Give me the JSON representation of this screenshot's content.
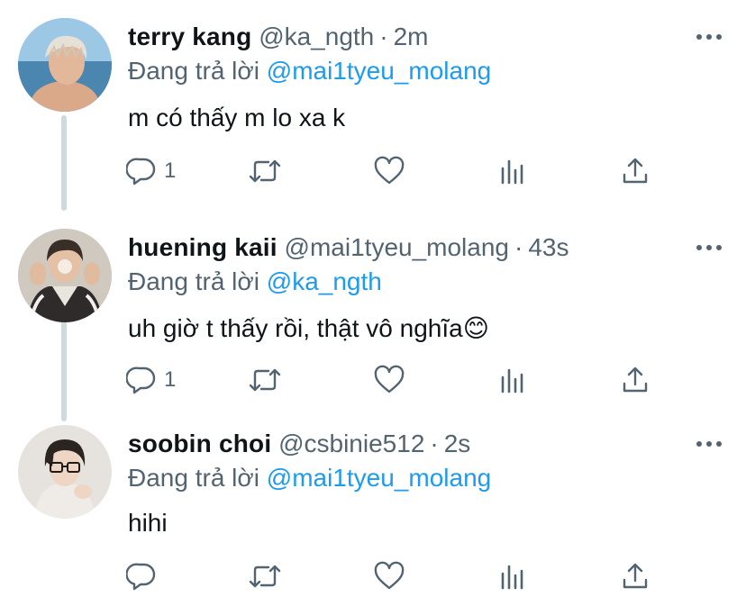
{
  "tweets": [
    {
      "name": "terry kang",
      "handle": "@ka_ngth",
      "time": "2m",
      "reply_prefix": "Đang trả lời ",
      "reply_to": "@mai1tyeu_molang",
      "text": "m có thấy m lo xa k",
      "reply_count": "1"
    },
    {
      "name": "huening kaii",
      "handle": "@mai1tyeu_molang",
      "time": "43s",
      "reply_prefix": "Đang trả lời ",
      "reply_to": "@ka_ngth",
      "text": "uh giờ t thấy rồi, thật vô nghĩa😊",
      "reply_count": "1"
    },
    {
      "name": "soobin choi",
      "handle": "@csbinie512",
      "time": "2s",
      "reply_prefix": "Đang trả lời ",
      "reply_to": "@mai1tyeu_molang",
      "text": "hihi",
      "reply_count": ""
    }
  ],
  "separator": "·",
  "icons": {
    "reply": "reply-icon",
    "retweet": "retweet-icon",
    "like": "heart-icon",
    "stats": "analytics-icon",
    "share": "share-icon",
    "more": "more-options-icon"
  },
  "colors": {
    "text": "#0f1419",
    "secondary": "#536471",
    "link": "#1d9bf0",
    "thread_line": "#cfd9de"
  }
}
